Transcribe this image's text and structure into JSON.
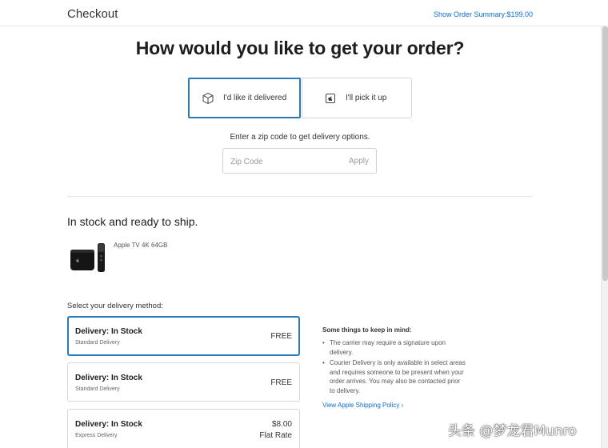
{
  "header": {
    "title": "Checkout",
    "order_summary_link": "Show Order Summary:$199.00"
  },
  "main": {
    "headline": "How would you like to get your order?",
    "options": [
      {
        "label": "I'd like it delivered",
        "icon": "box-icon",
        "selected": true
      },
      {
        "label": "I'll pick it up",
        "icon": "apple-store-icon",
        "selected": false
      }
    ],
    "zip_prompt": "Enter a zip code to get delivery options.",
    "zip_placeholder": "Zip Code",
    "zip_apply": "Apply"
  },
  "stock": {
    "title": "In stock and ready to ship.",
    "product_name": "Apple TV 4K 64GB"
  },
  "delivery": {
    "select_label": "Select your delivery method:",
    "methods": [
      {
        "title": "Delivery: In Stock",
        "subtitle": "Standard Delivery",
        "price": "FREE",
        "price2": "",
        "selected": true
      },
      {
        "title": "Delivery: In Stock",
        "subtitle": "Standard Delivery",
        "price": "FREE",
        "price2": "",
        "selected": false
      },
      {
        "title": "Delivery: In Stock",
        "subtitle": "Express Delivery",
        "price": "$8.00",
        "price2": "Flat Rate",
        "selected": false
      }
    ]
  },
  "notes": {
    "heading": "Some things to keep in mind:",
    "items": [
      "The carrier may require a signature upon delivery.",
      "Courier Delivery is only available in select areas and requires someone to be present when your order arrives. You may also be contacted prior to delivery."
    ],
    "policy_link": "View Apple Shipping Policy ›"
  },
  "watermark": "头条 @梦龙君Munro",
  "colors": {
    "accent": "#2a7ab8",
    "link": "#0a6fcf",
    "border": "#d6d6d6"
  }
}
